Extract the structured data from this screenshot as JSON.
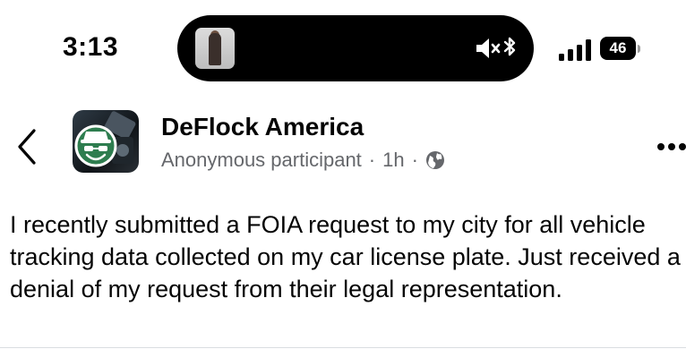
{
  "status_bar": {
    "time": "3:13",
    "battery_percent": "46",
    "icons": [
      "now-playing-album-art",
      "mute-icon",
      "bluetooth-icon",
      "cellular-signal-icon",
      "battery-icon"
    ]
  },
  "post": {
    "group_name": "DeFlock America",
    "author": "Anonymous participant",
    "separator": "·",
    "time_ago": "1h",
    "audience_icon": "globe-icon",
    "body": "I recently submitted a FOIA request to my city for all vehicle tracking data collected on my car license plate. Just received a denial of my request from their legal representation."
  },
  "colors": {
    "text_primary": "#050505",
    "text_secondary": "#65676b",
    "avatar_badge": "#2e7d4f",
    "status_bar_bg": "#000000"
  }
}
